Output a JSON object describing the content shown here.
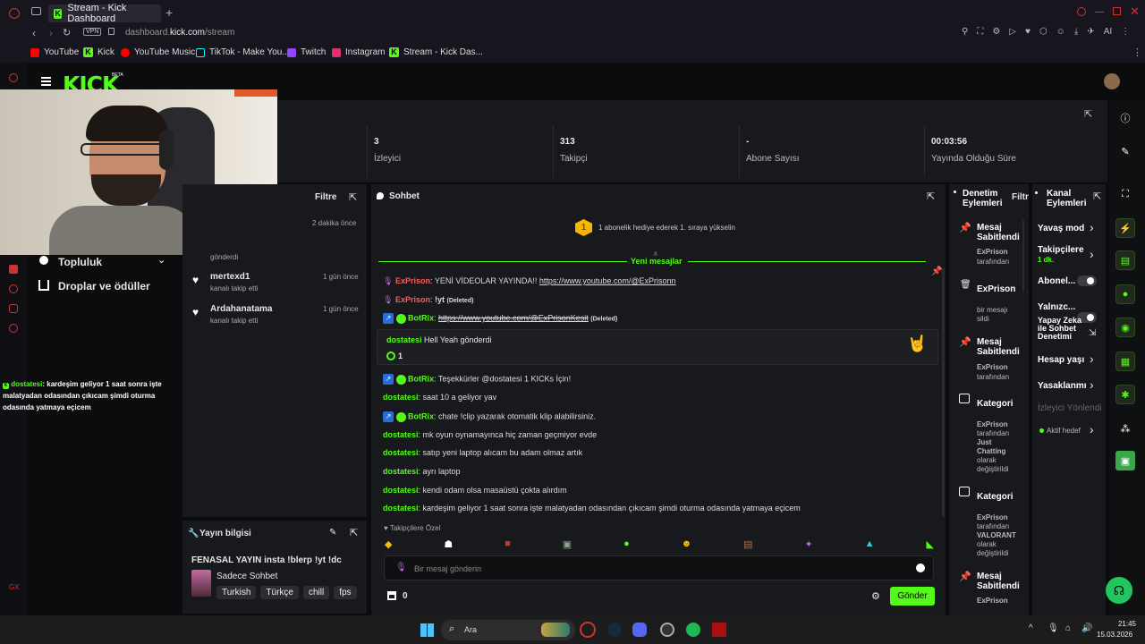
{
  "browser": {
    "tab_title": "Stream - Kick Dashboard",
    "url_prefix": "dashboard.",
    "url_domain": "kick.com",
    "url_path": "/stream",
    "vpn_label": "VPN",
    "ai_label": "AI",
    "bookmarks": [
      "YouTube",
      "Kick",
      "YouTube Music",
      "TikTok - Make You...",
      "Twitch",
      "Instagram",
      "Stream - Kick Das..."
    ]
  },
  "kick": {
    "logo": "KICK",
    "beta": "BETA"
  },
  "stats": [
    {
      "value": "3",
      "label": "İzleyici"
    },
    {
      "value": "313",
      "label": "Takipçi"
    },
    {
      "value": "-",
      "label": "Abone Sayısı"
    },
    {
      "value": "00:03:56",
      "label": "Yayında Olduğu Süre"
    }
  ],
  "left_nav": {
    "community": "Topluluk",
    "drops": "Droplar ve ödüller"
  },
  "overlay_chat": {
    "user": "dostatesi",
    "text": ": kardeşim geliyor 1 saat sonra işte malatyadan odasından çıkıcam şimdi oturma odasında yatmaya eçicem"
  },
  "activity": {
    "filter": "Filtre",
    "time_top": "2 dakika önce",
    "partial": "gönderdi",
    "items": [
      {
        "name": "mertexd1",
        "sub": "kanalı takip etti",
        "time": "1 gün önce"
      },
      {
        "name": "Ardahanatama",
        "sub": "kanalı takip etti",
        "time": "1 gün önce"
      }
    ]
  },
  "stream_info": {
    "title": "Yayın bilgisi",
    "stream_title": "FENASAL YAYIN insta !blerp !yt !dc",
    "category": "Sadece Sohbet",
    "tags": [
      "Turkish",
      "Türkçe",
      "chill",
      "fps"
    ]
  },
  "chat": {
    "title": "Sohbet",
    "hype_num": "1",
    "hype": "1 abonelik hediye ederek 1. sıraya yükselin",
    "new_messages": "Yeni mesajlar",
    "gift_user": "dostatesi",
    "gift_text": "Hell Yeah gönderdi",
    "gift_count": "1",
    "followers_only": "Takipçilere Özel",
    "placeholder": "Bir mesaj gönderin",
    "send": "Gönder",
    "points": "0",
    "deleted": "(Deleted)",
    "messages": [
      {
        "user": "ExPrison",
        "text": "YENİ VİDEOLAR YAYINDA!! ",
        "link": "https://www.youtube.com/@ExPrisonn",
        "deleted": ""
      },
      {
        "user": "ExPrison",
        "text": "!yt ",
        "link": "",
        "deleted": "(Deleted)"
      },
      {
        "user": "BotRix",
        "text": "",
        "link": "https://www.youtube.com/@ExPrisonKesit",
        "deleted": "(Deleted)"
      },
      {
        "user": "BotRix",
        "text": "Teşekkürler @dostatesi 1 KICKs İçin!",
        "link": "",
        "deleted": ""
      },
      {
        "user": "dostatesi",
        "text": "saat 10 a geliyor yav",
        "link": "",
        "deleted": ""
      },
      {
        "user": "BotRix",
        "text": "chate !clip yazarak otomatik klip alabilirsiniz.",
        "link": "",
        "deleted": ""
      },
      {
        "user": "dostatesi",
        "text": "mk oyun oynamayınca hiç zaman geçmiyor evde",
        "link": "",
        "deleted": ""
      },
      {
        "user": "dostatesi",
        "text": "satıp yeni laptop alıcam bu adam olmaz artık",
        "link": "",
        "deleted": ""
      },
      {
        "user": "dostatesi",
        "text": "ayrı laptop",
        "link": "",
        "deleted": ""
      },
      {
        "user": "dostatesi",
        "text": "kendi odam olsa masaüstü çokta alırdım",
        "link": "",
        "deleted": ""
      },
      {
        "user": "dostatesi",
        "text": "kardeşim geliyor 1 saat sonra işte malatyadan odasından çıkıcam şimdi oturma odasında yatmaya eçicem",
        "link": "",
        "deleted": ""
      }
    ]
  },
  "moderation": {
    "title": "Denetim Eylemleri",
    "filter": "Filtre",
    "items": [
      {
        "title": "Mesaj Sabitlendi",
        "user": "ExPrison",
        "sub": "tarafından",
        "extra": ""
      },
      {
        "title": "ExPrison",
        "user": "",
        "sub": "bir mesajı sildi",
        "extra": ""
      },
      {
        "title": "Mesaj Sabitlendi",
        "user": "ExPrison",
        "sub": "tarafından",
        "extra": ""
      },
      {
        "title": "Kategori",
        "user": "ExPrison",
        "sub": "tarafından",
        "extra": "Just Chatting",
        "tail": "olarak değiştirildi"
      },
      {
        "title": "Kategori",
        "user": "ExPrison",
        "sub": "tarafından",
        "extra": "VALORANT",
        "tail": "olarak değiştirildi"
      },
      {
        "title": "Mesaj Sabitlendi",
        "user": "ExPrison",
        "sub": "",
        "extra": ""
      }
    ]
  },
  "channel_actions": {
    "title": "Kanal Eylemleri",
    "slow": "Yavaş mod",
    "followers": "Takipçilere ...",
    "followers_val": "1 dk.",
    "subs": "Abonel...",
    "only": "Yalnızc...",
    "ai": "Yapay Zeka ile Sohbet Denetimi",
    "age": "Hesap yaşı",
    "banned": "Yasaklanmı",
    "viewer_redirect": "İzleyici Yönlendi",
    "target": "Aktif hedef"
  },
  "taskbar": {
    "search": "Ara",
    "time": "21:45",
    "date": "15.03.2026"
  }
}
